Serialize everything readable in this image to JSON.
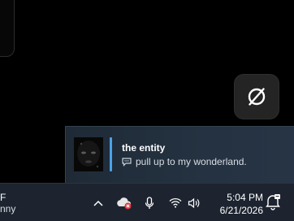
{
  "notification": {
    "title": "the entity",
    "message": "pull up to my wonderland."
  },
  "taskbar": {
    "weather_temp_fragment": "F",
    "weather_desc_fragment": "nny",
    "clock_time": "5:04 PM",
    "clock_date": "6/21/2026"
  },
  "icons": {
    "app_tile": "no-symbol-icon",
    "message": "chat-bubble-icon",
    "tray_overflow": "chevron-up-icon",
    "cloud_status": "cloud-error-icon",
    "microphone": "microphone-icon",
    "wifi": "wifi-icon",
    "volume": "speaker-icon",
    "notifications": "notification-bell-icon"
  },
  "colors": {
    "accent": "#4aa3e8",
    "error_badge": "#e0373d",
    "taskbar_bg": "#1d2430",
    "toast_bg": "#243241"
  }
}
